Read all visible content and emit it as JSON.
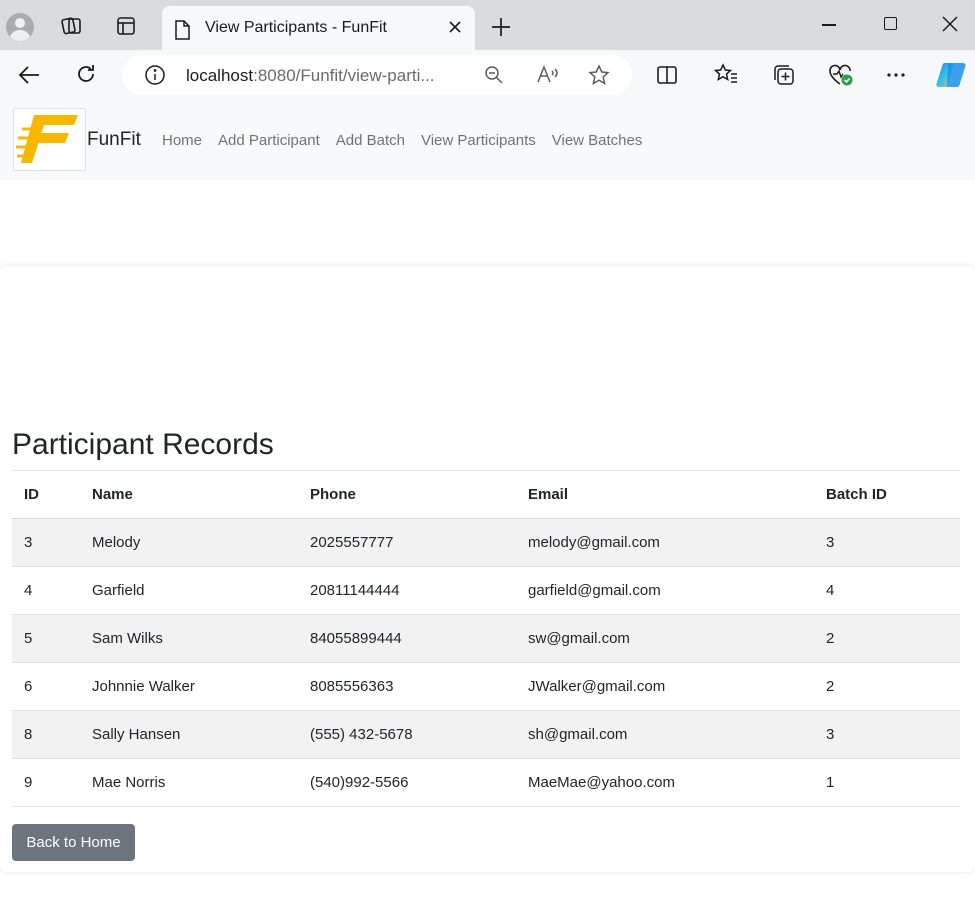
{
  "browser": {
    "tab_title": "View Participants - FunFit",
    "url_host": "localhost",
    "url_path": ":8080/Funfit/view-parti..."
  },
  "navbar": {
    "brand": "FunFit",
    "links": [
      "Home",
      "Add Participant",
      "Add Batch",
      "View Participants",
      "View Batches"
    ]
  },
  "page": {
    "title": "Participant Records",
    "back_label": "Back to Home"
  },
  "table": {
    "headers": [
      "ID",
      "Name",
      "Phone",
      "Email",
      "Batch ID"
    ],
    "rows": [
      [
        "3",
        "Melody",
        "2025557777",
        "melody@gmail.com",
        "3"
      ],
      [
        "4",
        "Garfield",
        "20811144444",
        "garfield@gmail.com",
        "4"
      ],
      [
        "5",
        "Sam Wilks",
        "84055899444",
        "sw@gmail.com",
        "2"
      ],
      [
        "6",
        "Johnnie Walker",
        "8085556363",
        "JWalker@gmail.com",
        "2"
      ],
      [
        "8",
        "Sally Hansen",
        "(555) 432-5678",
        "sh@gmail.com",
        "3"
      ],
      [
        "9",
        "Mae Norris",
        "(540)992-5566",
        "MaeMae@yahoo.com",
        "1"
      ]
    ]
  },
  "colors": {
    "logo_accent": "#f9b800",
    "button_secondary": "#6c757d",
    "row_stripe": "#f2f2f2"
  },
  "icons": [
    "profile-icon",
    "workspaces-icon",
    "tab-actions-icon",
    "document-icon",
    "close-icon",
    "new-tab-icon",
    "minimize-icon",
    "maximize-icon",
    "back-icon",
    "refresh-icon",
    "info-icon",
    "zoom-icon",
    "read-aloud-icon",
    "favorite-icon",
    "split-screen-icon",
    "favorites-icon",
    "collections-icon",
    "browser-essentials-icon",
    "more-icon",
    "copilot-icon"
  ]
}
